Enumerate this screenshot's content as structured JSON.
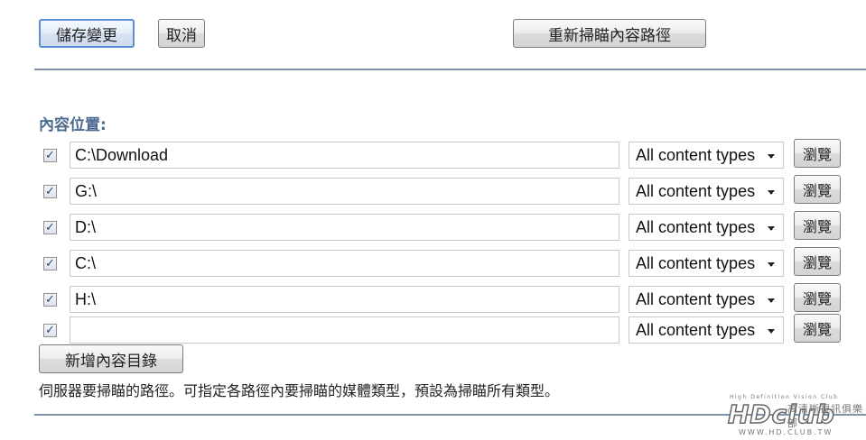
{
  "toolbar": {
    "save_label": "儲存變更",
    "cancel_label": "取消",
    "rescan_label": "重新掃瞄內容路徑"
  },
  "content_locations": {
    "title": "內容位置:",
    "rows": [
      {
        "checked": true,
        "path": "C:\\Download",
        "type": "All content types",
        "browse_label": "瀏覽"
      },
      {
        "checked": true,
        "path": "G:\\",
        "type": "All content types",
        "browse_label": "瀏覽"
      },
      {
        "checked": true,
        "path": "D:\\",
        "type": "All content types",
        "browse_label": "瀏覽"
      },
      {
        "checked": true,
        "path": "C:\\",
        "type": "All content types",
        "browse_label": "瀏覽"
      },
      {
        "checked": true,
        "path": "H:\\",
        "type": "All content types",
        "browse_label": "瀏覽"
      },
      {
        "checked": true,
        "path": "",
        "type": "All content types",
        "browse_label": "瀏覽"
      }
    ],
    "add_label": "新增內容目錄",
    "description": "伺服器要掃瞄的路徑。可指定各路徑內要掃瞄的媒體類型，預設為掃瞄所有類型。"
  },
  "watermark": {
    "tagline": "High Definition Vision Club",
    "logo_text": "HDclub",
    "chinese": "高清晰視訊俱樂部",
    "url": "WWW.HD.CLUB.TW"
  },
  "colors": {
    "accent": "#4c6a8e",
    "rule": "#7f93a8",
    "focus_border": "#5b8fd6"
  },
  "icons": {
    "checkbox": "checkmark-icon",
    "select": "chevron-down-icon"
  }
}
